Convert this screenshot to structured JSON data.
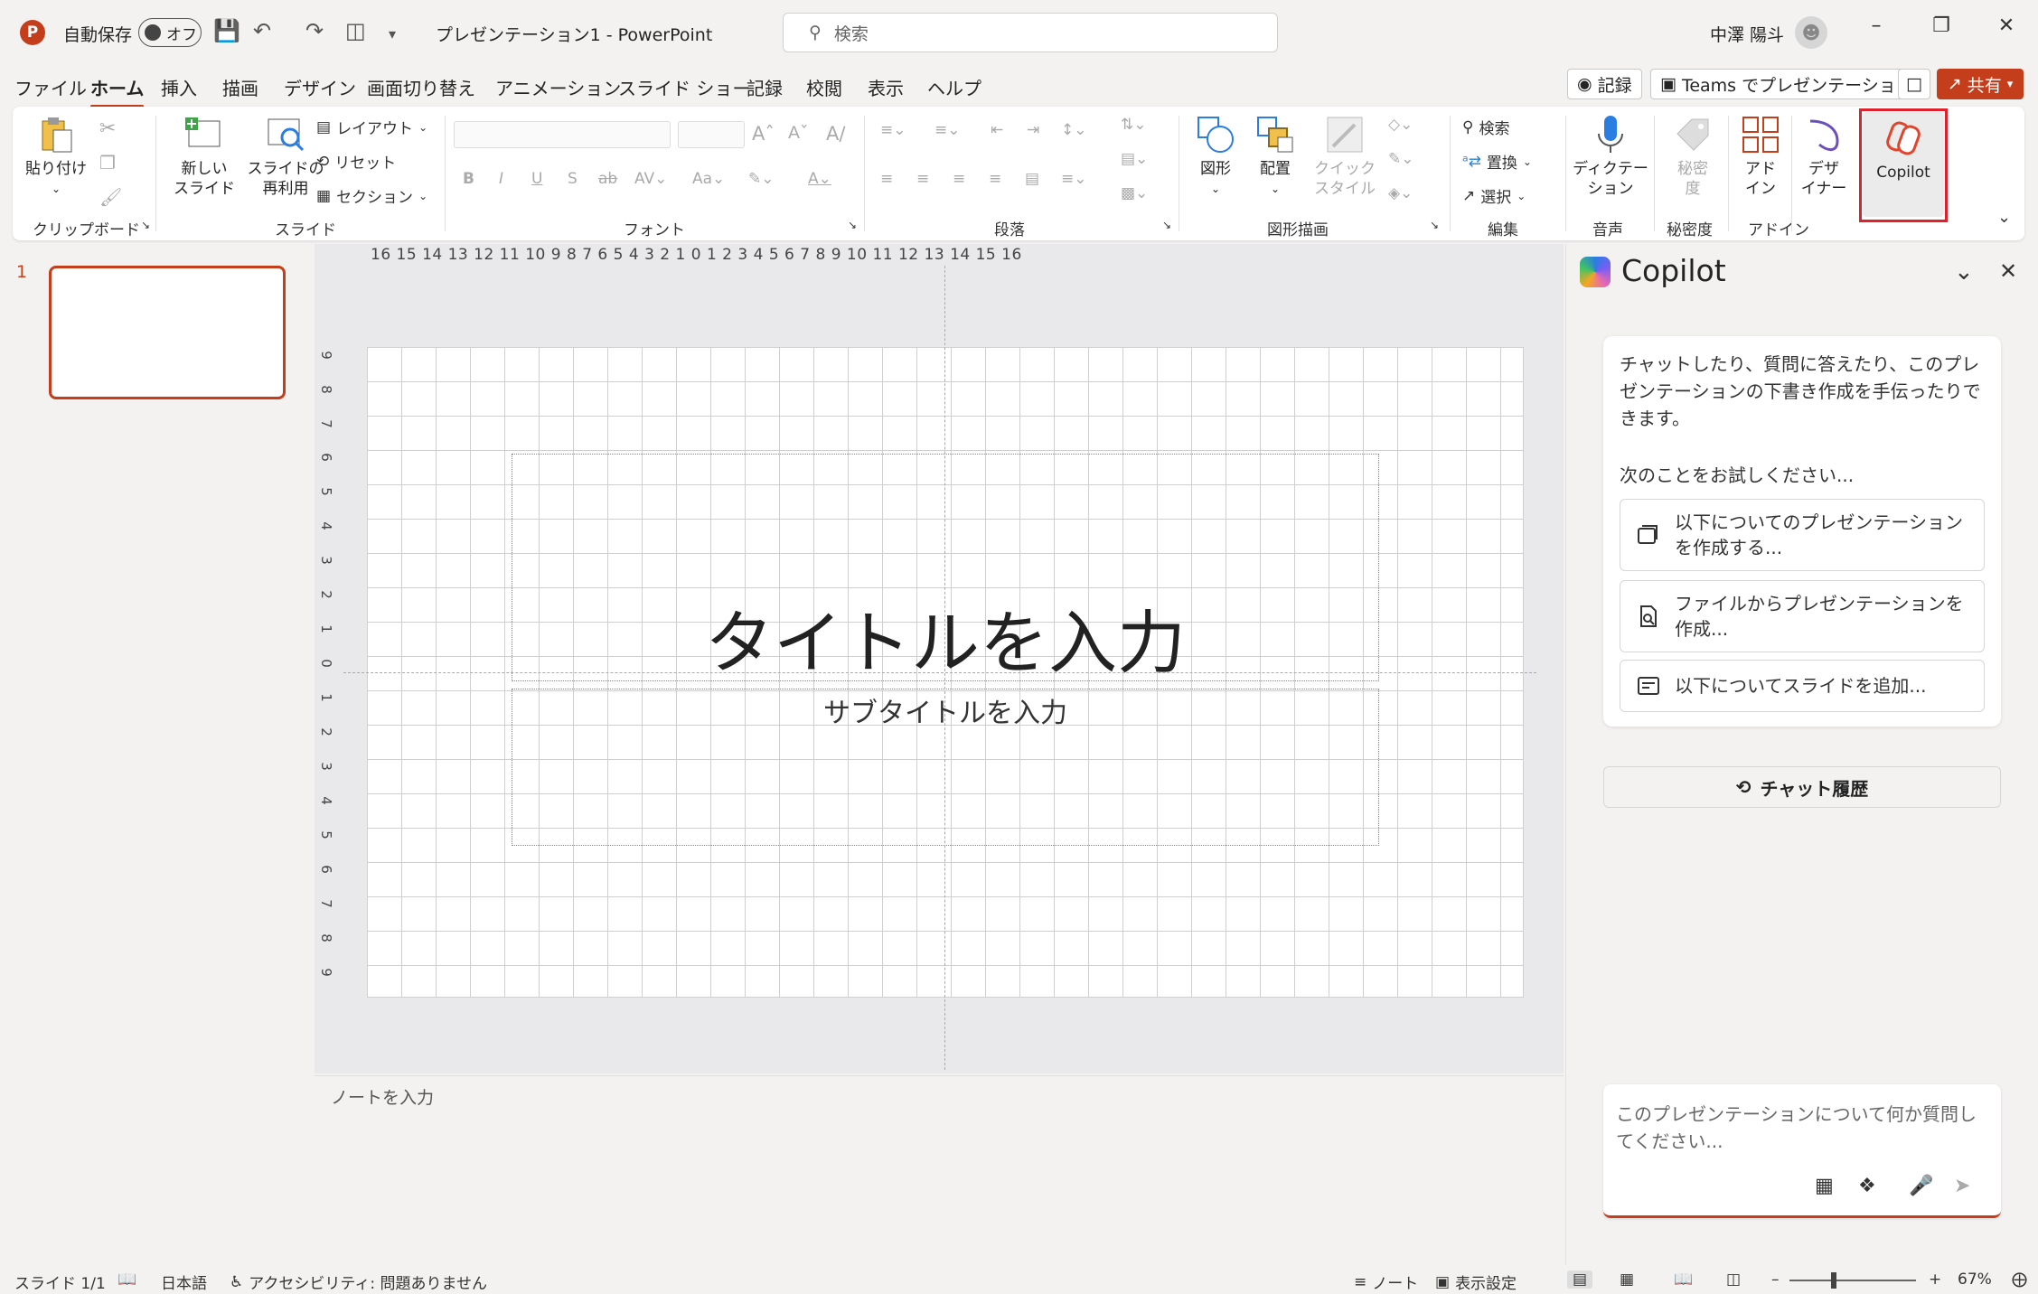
{
  "titlebar": {
    "autosave_label": "自動保存",
    "autosave_state": "オフ",
    "doc_title": "プレゼンテーション1  -  PowerPoint",
    "search_placeholder": "検索",
    "user_name": "中澤 陽斗"
  },
  "menu": {
    "tabs": [
      "ファイル",
      "ホーム",
      "挿入",
      "描画",
      "デザイン",
      "画面切り替え",
      "アニメーション",
      "スライド ショー",
      "記録",
      "校閲",
      "表示",
      "ヘルプ"
    ],
    "active_tab": "ホーム",
    "record_label": "記録",
    "teams_label": "Teams でプレゼンテーション",
    "share_label": "共有"
  },
  "ribbon": {
    "clipboard": {
      "paste": "貼り付け",
      "group": "クリップボード"
    },
    "slides": {
      "new_slide": "新しい\nスライド",
      "reuse": "スライドの\n再利用",
      "layout": "レイアウト",
      "reset": "リセット",
      "section": "セクション",
      "group": "スライド"
    },
    "font": {
      "group": "フォント"
    },
    "paragraph": {
      "group": "段落"
    },
    "drawing": {
      "shapes": "図形",
      "arrange": "配置",
      "quick_style": "クイック\nスタイル",
      "group": "図形描画"
    },
    "editing": {
      "find": "検索",
      "replace": "置換",
      "select": "選択",
      "group": "編集"
    },
    "voice": {
      "dictate": "ディクテー\nション",
      "group": "音声"
    },
    "sensitivity": {
      "label": "秘密\n度",
      "group": "秘密度"
    },
    "addins": {
      "label": "アド\nイン",
      "group": "アドイン"
    },
    "designer": {
      "label": "デザ\nイナー"
    },
    "copilot": {
      "label": "Copilot"
    }
  },
  "thumbs": {
    "number": "1"
  },
  "ruler": {
    "horizontal": "16 15 14 13 12 11 10 9 8 7 6 5 4 3 2 1 0 1 2 3 4 5 6 7 8 9 10 11 12 13 14 15 16",
    "vertical": [
      "9",
      "8",
      "7",
      "6",
      "5",
      "4",
      "3",
      "2",
      "1",
      "0",
      "1",
      "2",
      "3",
      "4",
      "5",
      "6",
      "7",
      "8",
      "9"
    ]
  },
  "slide": {
    "title_placeholder": "タイトルを入力",
    "subtitle_placeholder": "サブタイトルを入力"
  },
  "notes": {
    "placeholder": "ノートを入力"
  },
  "copilot_pane": {
    "title": "Copilot",
    "intro": "チャットしたり、質問に答えたり、このプレゼンテーションの下書き作成を手伝ったりできます。",
    "try_label": "次のことをお試しください...",
    "suggestions": [
      "以下についてのプレゼンテーションを作成する...",
      "ファイルからプレゼンテーションを作成...",
      "以下についてスライドを追加..."
    ],
    "history": "チャット履歴",
    "input_placeholder": "このプレゼンテーションについて何か質問してください..."
  },
  "status": {
    "slide_count": "スライド 1/1",
    "language": "日本語",
    "accessibility": "アクセシビリティ: 問題ありません",
    "notes": "ノート",
    "display_settings": "表示設定",
    "zoom": "67%"
  },
  "colors": {
    "accent": "#c43e1c",
    "highlight": "#e0202a"
  }
}
